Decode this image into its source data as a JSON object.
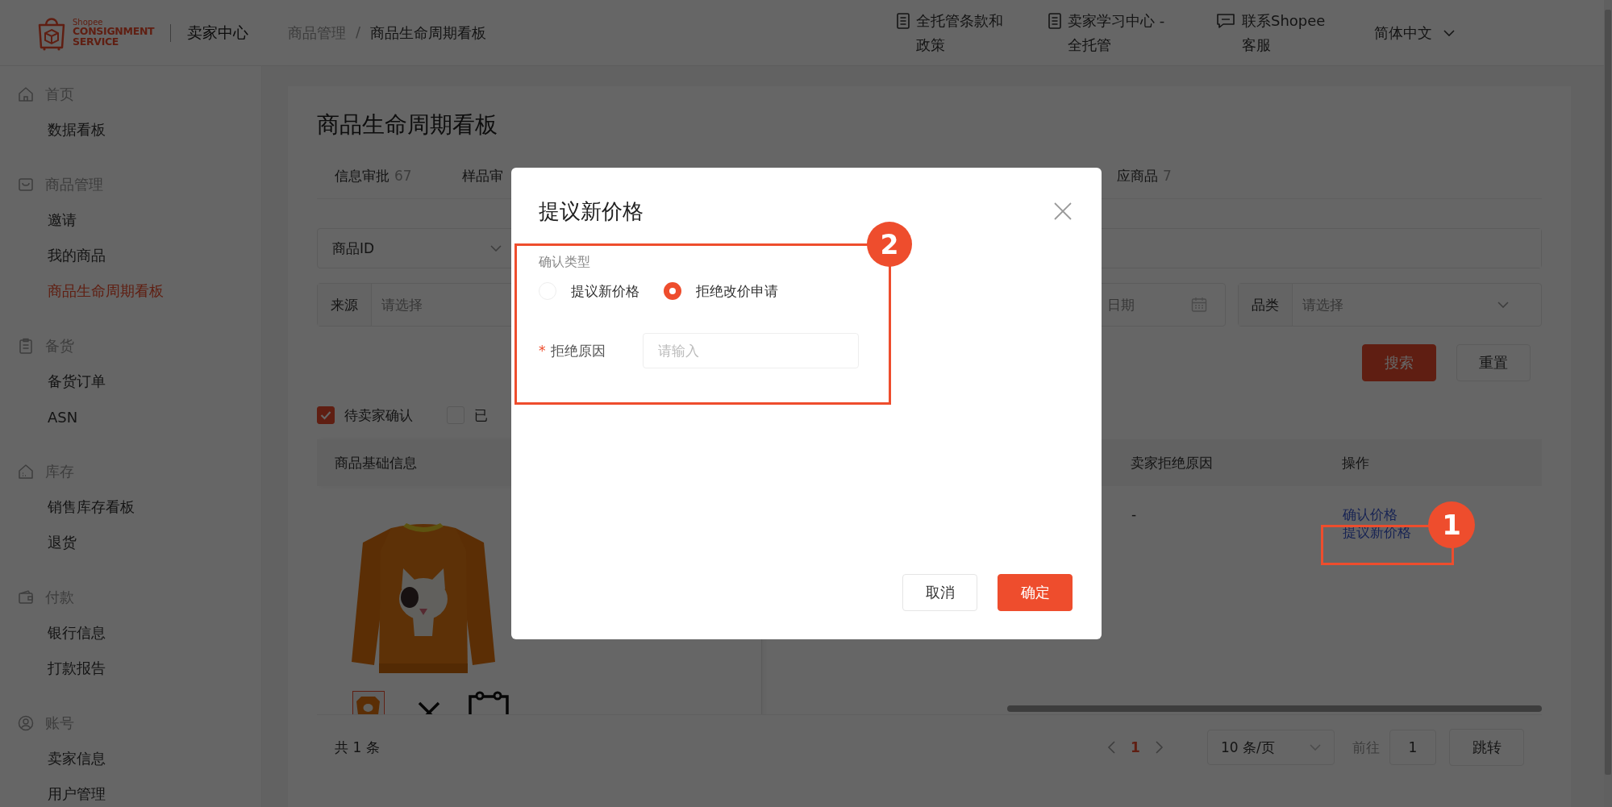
{
  "header": {
    "brand": {
      "tagline": "Shopee",
      "lines": [
        "CONSIGNMENT",
        "SERVICE"
      ]
    },
    "app_name": "卖家中心",
    "breadcrumb": [
      "商品管理",
      "商品生命周期看板"
    ],
    "breadcrumb_separator": "/",
    "links": [
      {
        "label": "全托管条款和政策"
      },
      {
        "label": "卖家学习中心 - 全托管"
      },
      {
        "label": "联系Shopee 客服"
      }
    ],
    "language": "简体中文"
  },
  "sidebar": {
    "sections": [
      {
        "title": "首页",
        "items": [
          {
            "label": "数据看板",
            "selected": false
          }
        ]
      },
      {
        "title": "商品管理",
        "items": [
          {
            "label": "邀请",
            "selected": false
          },
          {
            "label": "我的商品",
            "selected": false
          },
          {
            "label": "商品生命周期看板",
            "selected": true
          }
        ]
      },
      {
        "title": "备货",
        "items": [
          {
            "label": "备货订单",
            "selected": false
          },
          {
            "label": "ASN",
            "selected": false
          }
        ]
      },
      {
        "title": "库存",
        "items": [
          {
            "label": "销售库存看板",
            "selected": false
          },
          {
            "label": "退货",
            "selected": false
          }
        ]
      },
      {
        "title": "付款",
        "items": [
          {
            "label": "银行信息",
            "selected": false
          },
          {
            "label": "打款报告",
            "selected": false
          }
        ]
      },
      {
        "title": "账号",
        "items": [
          {
            "label": "卖家信息",
            "selected": false
          },
          {
            "label": "用户管理",
            "selected": false
          }
        ]
      }
    ]
  },
  "page": {
    "title": "商品生命周期看板",
    "tabs": [
      {
        "label": "信息审批",
        "count": "67"
      },
      {
        "label": "样品审"
      },
      {
        "label": "应商品",
        "count": "7"
      }
    ],
    "filters": {
      "id_select": "商品ID",
      "source": {
        "label": "来源",
        "placeholder": "请选择"
      },
      "date": {
        "placeholder": "日期"
      },
      "category": {
        "label": "品类",
        "placeholder": "请选择"
      }
    },
    "buttons": {
      "search": "搜索",
      "reset": "重置"
    },
    "status_filters": [
      {
        "label": "待卖家确认",
        "checked": true
      },
      {
        "label": "已",
        "checked": false
      }
    ],
    "table": {
      "columns": [
        "商品基础信息",
        "卖家拒绝原因",
        "操作"
      ],
      "rows": [
        {
          "seller_reject_reason": "-",
          "actions": [
            "确认价格",
            "提议新价格"
          ]
        }
      ]
    },
    "footer": {
      "total": "共 1 条",
      "pages": [
        {
          "label": "1",
          "selected": true
        }
      ],
      "page_size": "10 条/页",
      "goto_label": "前往",
      "goto_value": "1",
      "jump": "跳转"
    }
  },
  "modal": {
    "title": "提议新价格",
    "type_label": "确认类型",
    "options": [
      {
        "label": "提议新价格",
        "selected": false
      },
      {
        "label": "拒绝改价申请",
        "selected": true
      }
    ],
    "reason": {
      "required_mark": "*",
      "label": "拒绝原因",
      "placeholder": "请输入"
    },
    "buttons": {
      "cancel": "取消",
      "confirm": "确定"
    }
  },
  "annotations": [
    {
      "number": "1"
    },
    {
      "number": "2"
    }
  ]
}
